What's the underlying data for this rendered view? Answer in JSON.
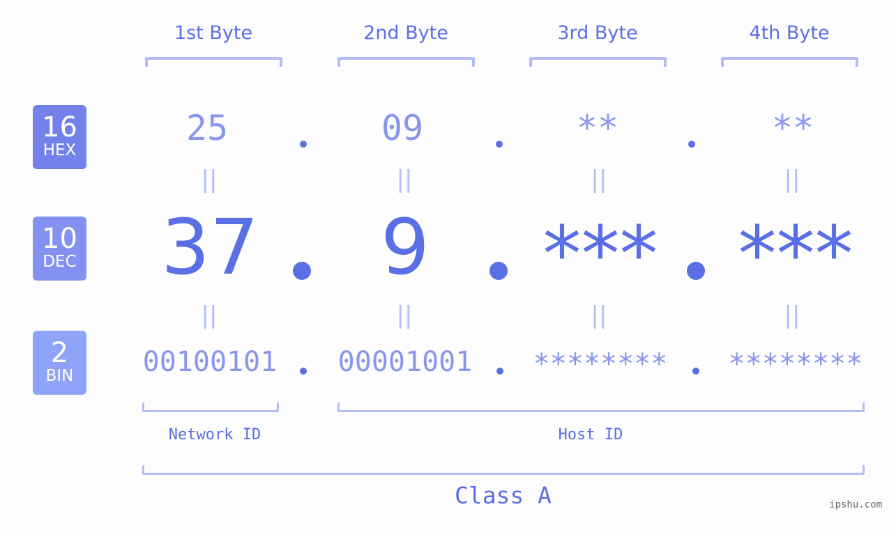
{
  "bytes": [
    {
      "header": "1st Byte",
      "hex": "25",
      "dec": "37",
      "bin": "00100101"
    },
    {
      "header": "2nd Byte",
      "hex": "09",
      "dec": "9",
      "bin": "00001001"
    },
    {
      "header": "3rd Byte",
      "hex": "**",
      "dec": "***",
      "bin": "********"
    },
    {
      "header": "4th Byte",
      "hex": "**",
      "dec": "***",
      "bin": "********"
    }
  ],
  "badges": {
    "hex": {
      "number": "16",
      "label": "HEX",
      "color": "#7282ea"
    },
    "dec": {
      "number": "10",
      "label": "DEC",
      "color": "#8392f0"
    },
    "bin": {
      "number": "2",
      "label": "BIN",
      "color": "#8fa4f8"
    }
  },
  "equals_sign": "||",
  "network_id_label": "Network ID",
  "host_id_label": "Host ID",
  "class_label": "Class A",
  "watermark": "ipshu.com",
  "colors": {
    "primary": "#5a6ee6",
    "secondary": "#8896ee",
    "bracket": "#b3bdf8",
    "background": "#fcfdfc"
  }
}
